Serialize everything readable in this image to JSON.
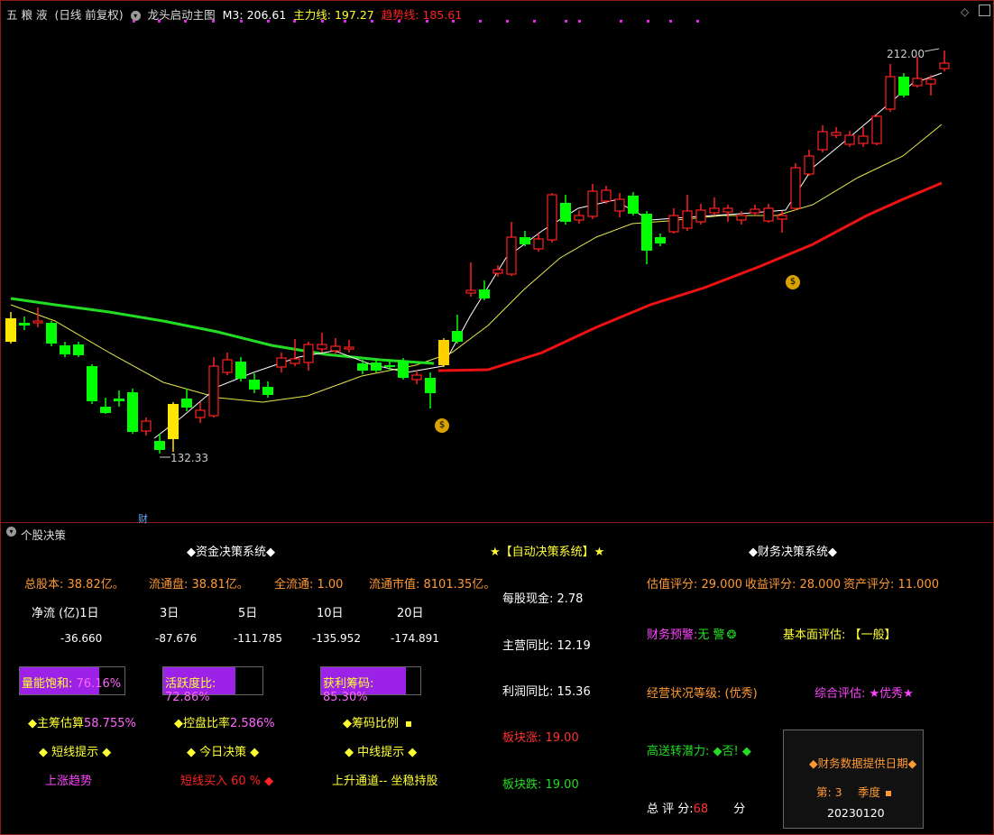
{
  "header": {
    "stock": "五 粮 液",
    "period": "(日线 前复权)",
    "indicator": "龙头启动主图",
    "m3": "M3: 206.61",
    "main_line": "主力线: 197.27",
    "trend_line": "趋势线: 185.61"
  },
  "chart_labels": {
    "high_price": "212.00",
    "low_price": "132.33",
    "cai": "财"
  },
  "colors": {
    "up": "#ff2020",
    "down": "#00ff00",
    "yellow_line": "#e6e64a",
    "green_line": "#22dd22",
    "red_line": "#ee1111",
    "white_line": "#ffffff",
    "gold": "#ffd000"
  },
  "panel_title": "个股决策",
  "fund": {
    "title": "◆资金决策系统◆",
    "total_shares": "总股本: 38.82亿。",
    "float_shares": "流通盘: 38.81亿。",
    "full_float": "全流通: 1.00",
    "float_mv": "流通市值: 8101.35亿。",
    "net_flow_label": "净流 (亿)1日",
    "d3": "3日",
    "d5": "5日",
    "d10": "10日",
    "d20": "20日",
    "v1": "-36.660",
    "v3": "-87.676",
    "v5": "-111.785",
    "v10": "-135.952",
    "v20": "-174.891",
    "bar1_label": "量能饱和: ",
    "bar1_value": "76.16%",
    "bar1_pct": 76.16,
    "bar2_label": "活跃度比: ",
    "bar2_value": "72.86%",
    "bar2_pct": 72.86,
    "bar3_label": "获利筹码: ",
    "bar3_value": "85.30%",
    "bar3_pct": 85.3,
    "main_chip": "◆主筹估算",
    "main_chip_val": "58.755%",
    "control_rate": "◆控盘比率",
    "control_rate_val": "2.586%",
    "chip_ratio": "◆筹码比例",
    "short_tip": "◆ 短线提示 ◆",
    "today_decision": "◆ 今日决策 ◆",
    "mid_tip": "◆ 中线提示 ◆",
    "short_val": "上涨趋势",
    "today_val": "短线买入 60 %",
    "mid_val": "上升通道-- 坐稳持股"
  },
  "auto": {
    "title": "★【自动决策系统】★",
    "cash_ps": "每股现金: 2.78",
    "rev_yoy": "主营同比: 12.19",
    "profit_yoy": "利润同比: 15.36",
    "sector_up": "板块涨: 19.00",
    "sector_down": "板块跌: 19.00"
  },
  "fin": {
    "title": "◆财务决策系统◆",
    "valuation": "估值评分: 29.000",
    "income": "收益评分: 28.000",
    "asset": "资产评分: 11.000",
    "warning": "财务预警:",
    "warning_val": "无 警",
    "fundamental": "基本面评估: 【一般】",
    "op_grade": "经营状况等级: (优秀)",
    "overall": "综合评估: ★优秀★",
    "transfer": "高送转潜力: ◆否! ◆",
    "score_label": "总 评 分:",
    "score_val": "68",
    "score_unit": "分",
    "box_title": "◆财务数据提供日期◆",
    "box_quarter": "第: 3",
    "box_season": "季度",
    "box_date": "20230120"
  }
}
